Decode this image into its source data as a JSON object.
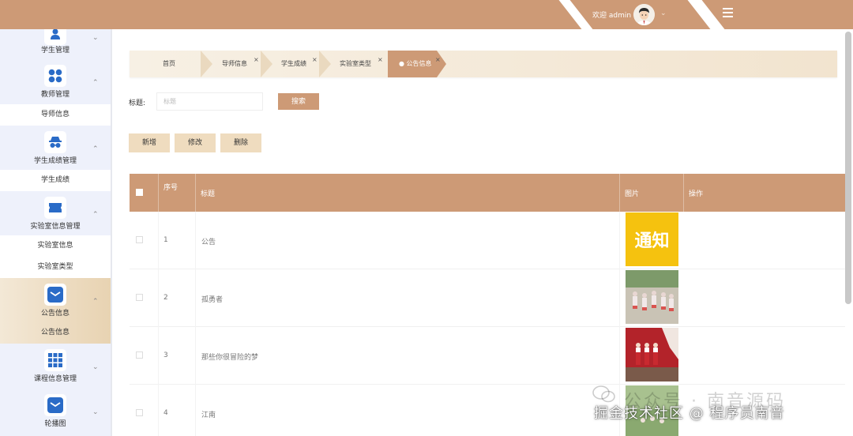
{
  "header": {
    "welcome": "欢迎 admin",
    "accent": "#cd9a76",
    "user_icon": "user-avatar-icon",
    "menu_icon": "hamburger-menu-icon"
  },
  "sidebar": {
    "groups": [
      {
        "label": "学生管理",
        "icon": "student-icon"
      },
      {
        "label": "教师管理",
        "icon": "grid-circles-icon",
        "children": [
          "导师信息"
        ]
      },
      {
        "label": "学生成绩管理",
        "icon": "spy-icon",
        "children": [
          "学生成绩"
        ]
      },
      {
        "label": "实验室信息管理",
        "icon": "ticket-icon",
        "children": [
          "实验室信息",
          "实验室类型"
        ]
      },
      {
        "label": "公告信息",
        "icon": "mail-icon",
        "children": [
          "公告信息"
        ]
      },
      {
        "label": "课程信息管理",
        "icon": "grid-squares-icon"
      },
      {
        "label": "轮播图",
        "icon": "mail-icon"
      }
    ]
  },
  "breadcrumb": {
    "items": [
      "首页",
      "导师信息",
      "学生成绩",
      "实验室类型"
    ],
    "active": "公告信息",
    "close_glyph": "×"
  },
  "search": {
    "label": "标题:",
    "placeholder": "标题",
    "button": "搜索"
  },
  "actions": {
    "add": "新增",
    "edit": "修改",
    "delete": "删除"
  },
  "table": {
    "headers": {
      "index": "序号",
      "title": "标题",
      "image": "图片",
      "ops": "操作"
    },
    "rows": [
      {
        "index": "1",
        "title": "公告",
        "image": "notice-image"
      },
      {
        "index": "2",
        "title": "孤勇者",
        "image": "group-dance-photo"
      },
      {
        "index": "3",
        "title": "那些你很冒险的梦",
        "image": "stage-photo"
      },
      {
        "index": "4",
        "title": "江南",
        "image": "outdoor-photo"
      }
    ],
    "notice_text": "通知"
  },
  "watermarks": {
    "wechat": "公众号 · 南音源码",
    "juejin": "掘金技术社区 @ 程序员南音"
  }
}
